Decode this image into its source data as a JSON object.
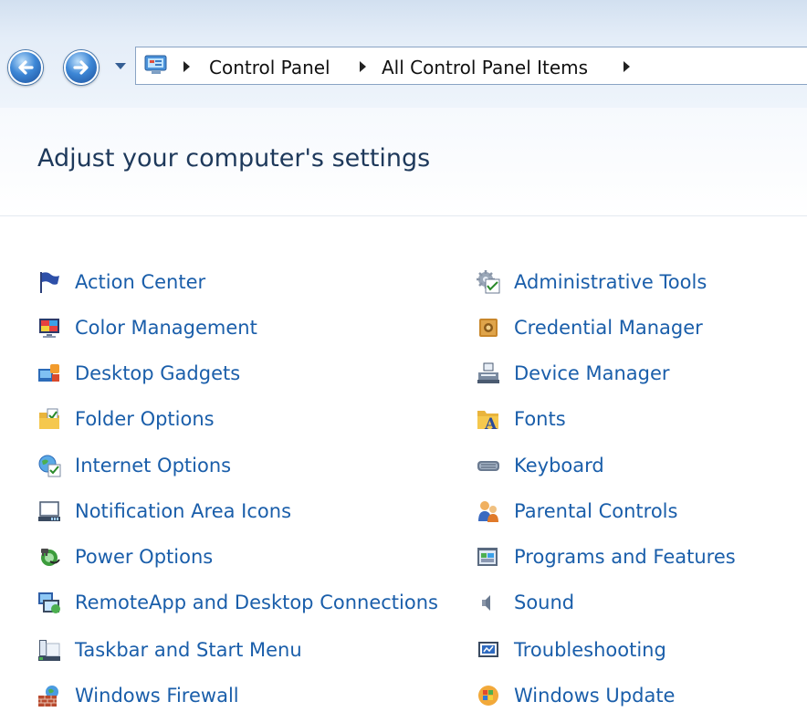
{
  "navigation": {
    "back_icon": "back-arrow-icon",
    "forward_icon": "forward-arrow-icon",
    "recent_icon": "dropdown-icon",
    "breadcrumb": [
      "Control Panel",
      "All Control Panel Items"
    ]
  },
  "header": {
    "title": "Adjust your computer's settings"
  },
  "colors": {
    "link": "#1a5eaa",
    "title": "#1e395b",
    "nav_bg": "#dbe7f5"
  },
  "items_left": [
    {
      "label": "Action Center",
      "icon": "flag-icon"
    },
    {
      "label": "Color Management",
      "icon": "monitor-color-icon"
    },
    {
      "label": "Desktop Gadgets",
      "icon": "gadgets-icon"
    },
    {
      "label": "Folder Options",
      "icon": "folder-options-icon"
    },
    {
      "label": "Internet Options",
      "icon": "globe-icon"
    },
    {
      "label": "Notification Area Icons",
      "icon": "notification-area-icon"
    },
    {
      "label": "Power Options",
      "icon": "power-icon"
    },
    {
      "label": "RemoteApp and Desktop Connections",
      "icon": "remote-desktop-icon"
    },
    {
      "label": "Taskbar and Start Menu",
      "icon": "taskbar-icon"
    },
    {
      "label": "Windows Firewall",
      "icon": "firewall-icon"
    }
  ],
  "items_right": [
    {
      "label": "Administrative Tools",
      "icon": "admin-tools-icon"
    },
    {
      "label": "Credential Manager",
      "icon": "vault-icon"
    },
    {
      "label": "Device Manager",
      "icon": "device-manager-icon"
    },
    {
      "label": "Fonts",
      "icon": "fonts-icon"
    },
    {
      "label": "Keyboard",
      "icon": "keyboard-icon"
    },
    {
      "label": "Parental Controls",
      "icon": "parental-controls-icon"
    },
    {
      "label": "Programs and Features",
      "icon": "programs-icon"
    },
    {
      "label": "Sound",
      "icon": "speaker-icon"
    },
    {
      "label": "Troubleshooting",
      "icon": "troubleshooting-icon"
    },
    {
      "label": "Windows Update",
      "icon": "windows-update-icon"
    }
  ]
}
